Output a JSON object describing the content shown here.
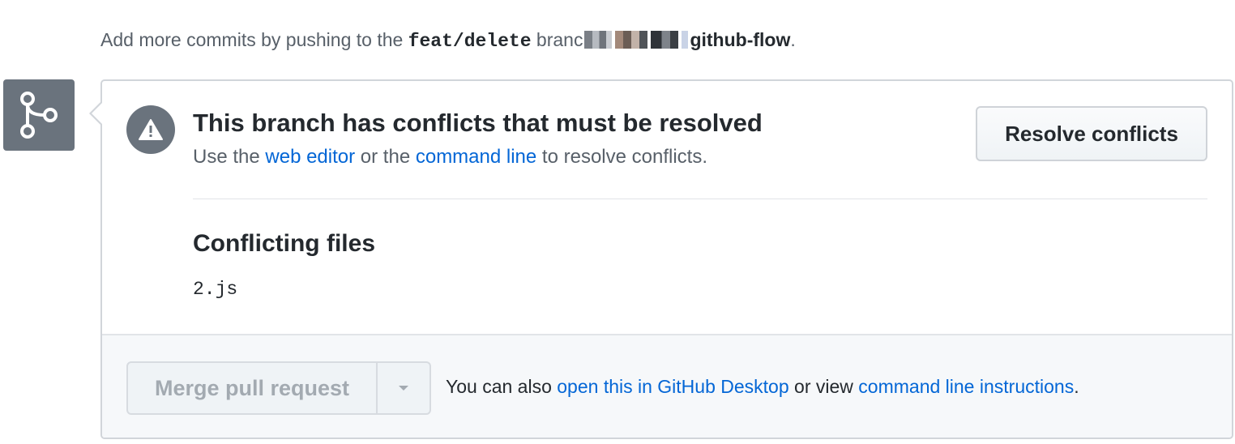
{
  "top_line": {
    "prefix": "Add more commits by pushing to the ",
    "branch": "feat/delete",
    "middle": " branc",
    "repo": "github-flow",
    "suffix": "."
  },
  "conflict": {
    "title": "This branch has conflicts that must be resolved",
    "desc_prefix": "Use the ",
    "web_editor_link": "web editor",
    "desc_middle": " or the ",
    "command_line_link": "command line",
    "desc_suffix": " to resolve conflicts.",
    "resolve_button": "Resolve conflicts"
  },
  "conflicting_files": {
    "title": "Conflicting files",
    "files": [
      "2.js"
    ]
  },
  "footer": {
    "merge_button": "Merge pull request",
    "text_prefix": "You can also ",
    "desktop_link": "open this in GitHub Desktop",
    "text_middle": " or view ",
    "instructions_link": "command line instructions",
    "text_suffix": "."
  },
  "colors": {
    "link": "#0366d6",
    "icon_bg": "#6a737d",
    "border": "#d1d5da"
  }
}
